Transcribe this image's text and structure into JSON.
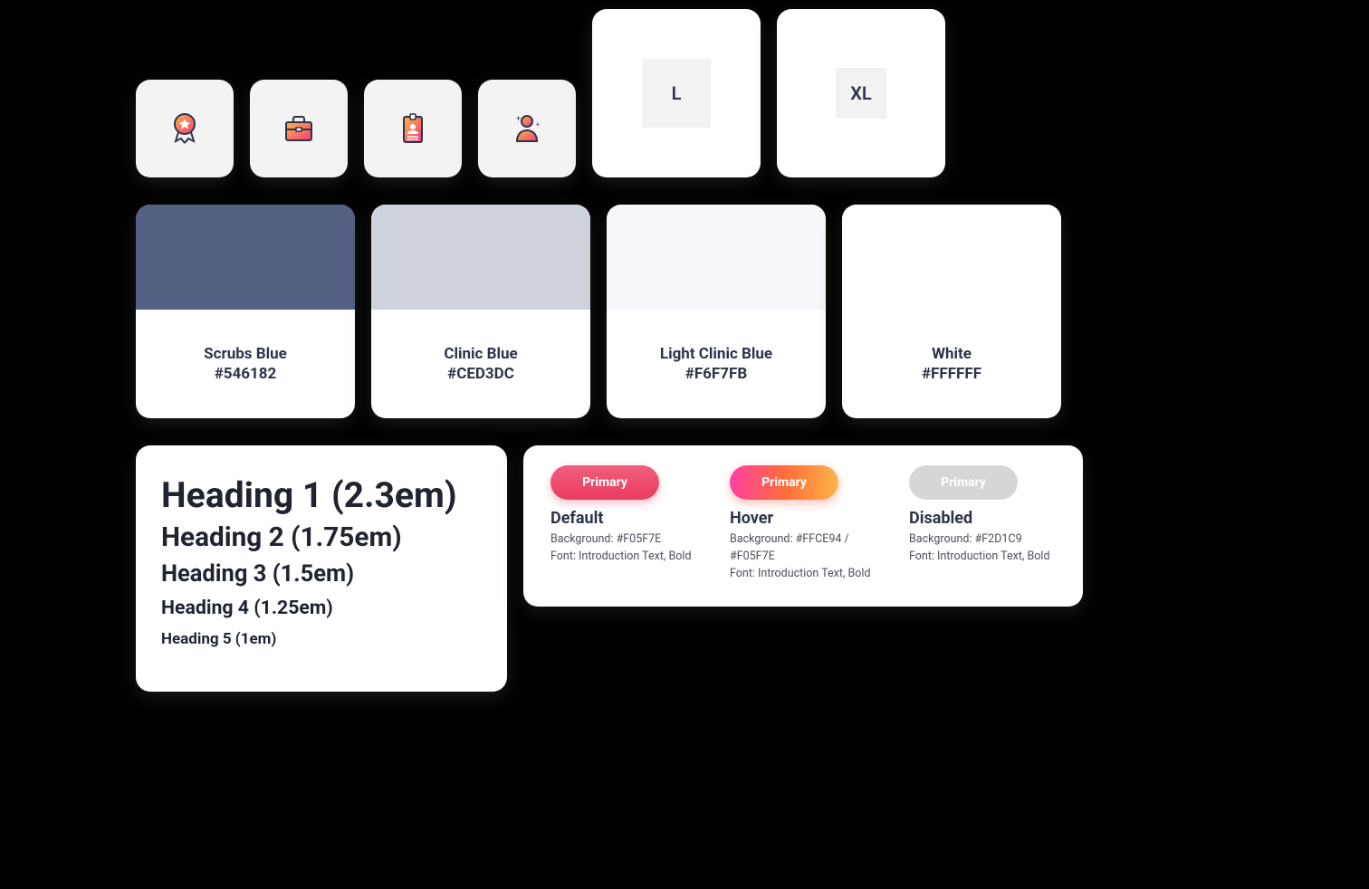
{
  "icons": {
    "award": "award-icon",
    "briefcase": "briefcase-icon",
    "id_badge": "id-badge-icon",
    "user": "user-icon"
  },
  "sizes": {
    "l": "L",
    "xl": "XL"
  },
  "colors": [
    {
      "name": "Scrubs Blue",
      "hex": "#546182",
      "fill": "#546182"
    },
    {
      "name": "Clinic Blue",
      "hex": "#CED3DC",
      "fill": "#CED3DC"
    },
    {
      "name": "Light Clinic Blue",
      "hex": "#F6F7FB",
      "fill": "#F6F7FB"
    },
    {
      "name": "White",
      "hex": "#FFFFFF",
      "fill": "#FFFFFF"
    }
  ],
  "typography": {
    "h1": "Heading 1 (2.3em)",
    "h2": "Heading 2 (1.75em)",
    "h3": "Heading 3 (1.5em)",
    "h4": "Heading 4 (1.25em)",
    "h5": "Heading 5 (1em)"
  },
  "buttons": {
    "label": "Primary",
    "default": {
      "state": "Default",
      "bg": "Background: #F05F7E",
      "font": "Font: Introduction Text, Bold"
    },
    "hover": {
      "state": "Hover",
      "bg": "Background: #FFCE94 / #F05F7E",
      "font": "Font: Introduction Text, Bold"
    },
    "disabled": {
      "state": "Disabled",
      "bg": "Background: #F2D1C9",
      "font": "Font: Introduction Text, Bold"
    }
  }
}
